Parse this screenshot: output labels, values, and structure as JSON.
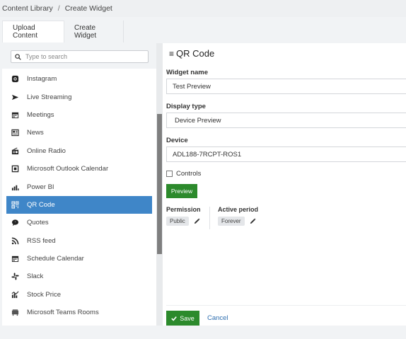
{
  "breadcrumb": {
    "root": "Content Library",
    "separator": "/",
    "current": "Create Widget"
  },
  "tabs": [
    {
      "label": "Upload Content"
    },
    {
      "label": "Create Widget"
    }
  ],
  "search": {
    "placeholder": "Type to search",
    "value": ""
  },
  "sidebar": {
    "items": [
      {
        "label": "Instagram",
        "icon": "instagram-icon"
      },
      {
        "label": "Live Streaming",
        "icon": "live-stream-icon"
      },
      {
        "label": "Meetings",
        "icon": "calendar-icon"
      },
      {
        "label": "News",
        "icon": "news-icon"
      },
      {
        "label": "Online Radio",
        "icon": "radio-icon"
      },
      {
        "label": "Microsoft Outlook Calendar",
        "icon": "calendar-box-icon"
      },
      {
        "label": "Power BI",
        "icon": "bar-chart-icon"
      },
      {
        "label": "QR Code",
        "icon": "qr-code-icon",
        "active": true
      },
      {
        "label": "Quotes",
        "icon": "quote-icon"
      },
      {
        "label": "RSS feed",
        "icon": "rss-icon"
      },
      {
        "label": "Schedule Calendar",
        "icon": "calendar-icon"
      },
      {
        "label": "Slack",
        "icon": "slack-icon"
      },
      {
        "label": "Stock Price",
        "icon": "stock-chart-icon"
      },
      {
        "label": "Microsoft Teams Rooms",
        "icon": "teams-rooms-icon"
      }
    ]
  },
  "main": {
    "title": "QR Code",
    "widget_name_label": "Widget name",
    "widget_name_value": "Test Preview",
    "display_type_label": "Display type",
    "display_type_value": "Device Preview",
    "device_label": "Device",
    "device_value": "ADL188-7RCPT-ROS1",
    "controls_label": "Controls",
    "controls_checked": false,
    "preview_label": "Preview",
    "permission_label": "Permission",
    "permission_value": "Public",
    "active_period_label": "Active period",
    "active_period_value": "Forever",
    "save_label": "Save",
    "cancel_label": "Cancel"
  },
  "colors": {
    "accent": "#3f86c8",
    "primary_button": "#2c8a2c",
    "link": "#2f6fb0"
  }
}
